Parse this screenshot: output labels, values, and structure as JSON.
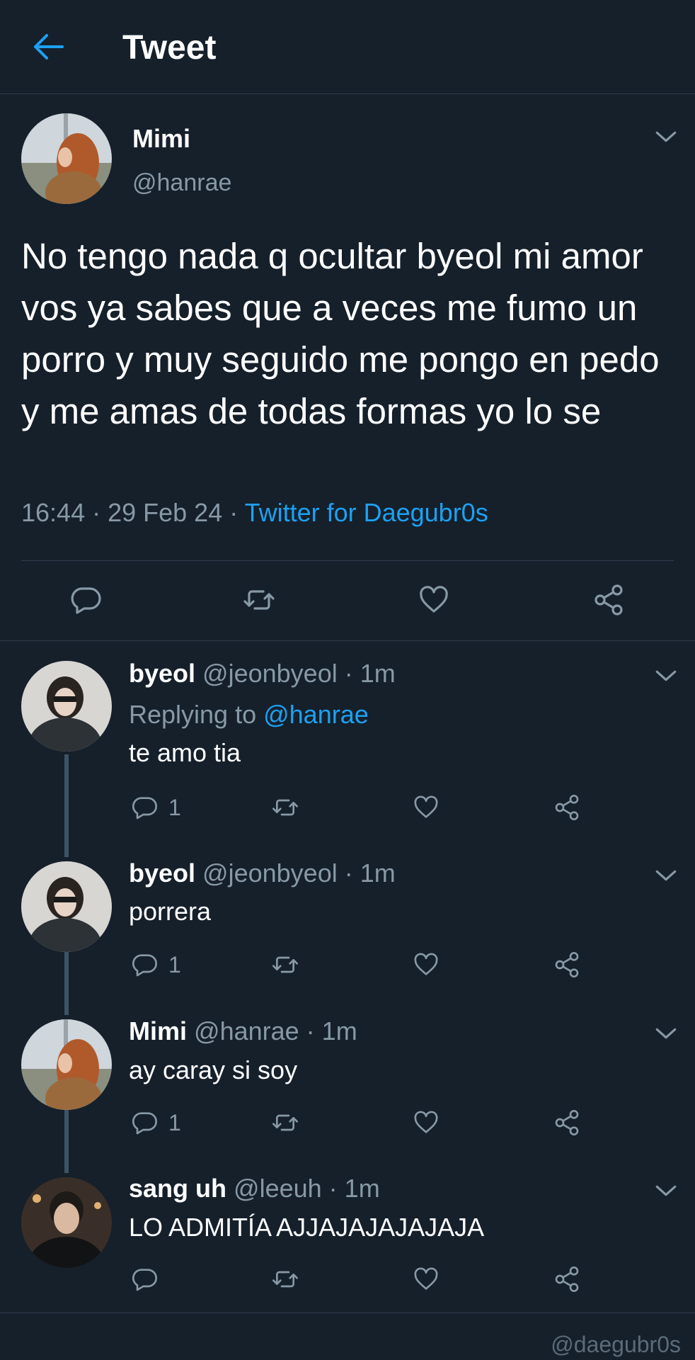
{
  "header": {
    "title": "Tweet",
    "back_icon": "arrow-left-icon"
  },
  "colors": {
    "background": "#15202b",
    "accent": "#1da1f2",
    "muted": "#8899a6",
    "divider": "#2f3d4b"
  },
  "main_tweet": {
    "name": "Mimi",
    "handle": "@hanrae",
    "text": "No tengo nada q ocultar byeol mi amor vos ya sabes que a veces me fumo un porro y muy seguido me pongo en pedo y me amas de todas formas yo lo se",
    "time": "16:44",
    "date": "29 Feb 24",
    "source": "Twitter for Daegubr0s",
    "sep": " · "
  },
  "replies": [
    {
      "name": "byeol",
      "handle": "@jeonbyeol",
      "time": "1m",
      "replying_prefix": "Replying to ",
      "replying_to": "@hanrae",
      "text": "te amo tia",
      "reply_count": "1"
    },
    {
      "name": "byeol",
      "handle": "@jeonbyeol",
      "time": "1m",
      "text": "porrera",
      "reply_count": "1"
    },
    {
      "name": "Mimi",
      "handle": "@hanrae",
      "time": "1m",
      "text": "ay caray si soy",
      "reply_count": "1"
    },
    {
      "name": "sang uh",
      "handle": "@leeuh",
      "time": "1m",
      "text": "LO ADMITÍA AJJAJAJAJAJAJA",
      "reply_count": ""
    }
  ],
  "watermark": "@daegubr0s"
}
